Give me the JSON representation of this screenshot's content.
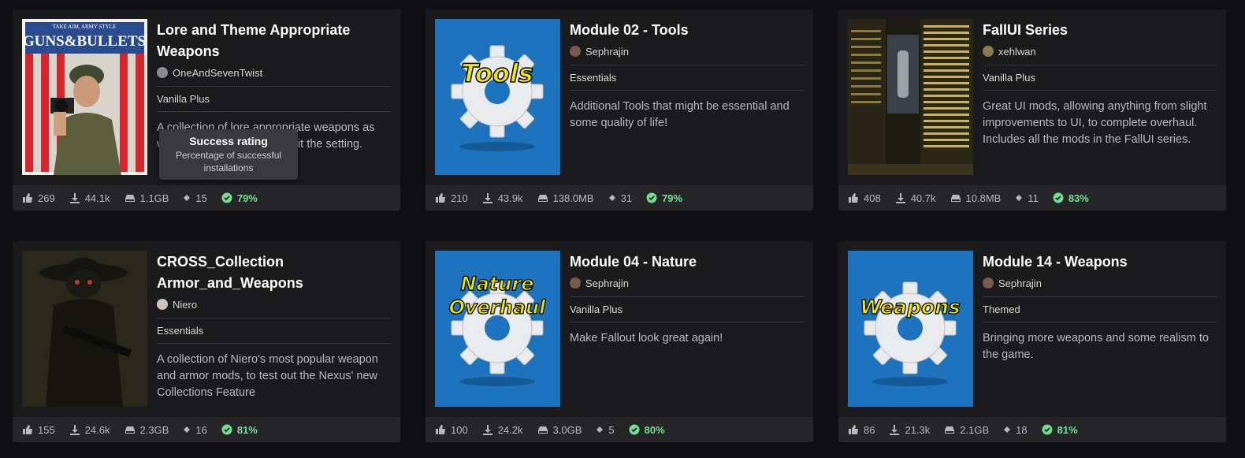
{
  "colors": {
    "background": "#101012",
    "card": "#1b1b1e",
    "stats_bar": "#262629",
    "success": "#6fe08f",
    "thumb_blue": "#1e73be",
    "gear_label": "#f2e600"
  },
  "icons": {
    "endorsements": "thumbs-up-icon",
    "downloads": "download-icon",
    "size": "hard-drive-icon",
    "mods": "diamond-icon",
    "success": "check-circle-icon"
  },
  "tooltip": {
    "title": "Success rating",
    "body": "Percentage of successful installations"
  },
  "cards": [
    {
      "title": "Lore and Theme Appropriate Weapons",
      "author": "OneAndSevenTwist",
      "category": "Vanilla Plus",
      "description": "A collection of lore appropriate weapons as well as mods that naturally fit the setting.",
      "thumb_label": "",
      "poster_top": "TAKE AIM, ARMY STYLE",
      "poster_brand": "GUNS&BULLETS",
      "stats": {
        "endorsements": "269",
        "downloads": "44.1k",
        "size": "1.1GB",
        "mods": "15",
        "success": "79%"
      }
    },
    {
      "title": "Module 02 - Tools",
      "author": "Sephrajin",
      "category": "Essentials",
      "description": "Additional Tools that might be essential and some quality of life!",
      "thumb_label": "Tools",
      "stats": {
        "endorsements": "210",
        "downloads": "43.9k",
        "size": "138.0MB",
        "mods": "31",
        "success": "79%"
      }
    },
    {
      "title": "FallUI Series",
      "author": "xehlwan",
      "category": "Vanilla Plus",
      "description": "Great UI mods, allowing anything from slight improvements to UI, to complete overhaul. Includes all the mods in the FallUI series.",
      "thumb_label": "",
      "stats": {
        "endorsements": "408",
        "downloads": "40.7k",
        "size": "10.8MB",
        "mods": "11",
        "success": "83%"
      }
    },
    {
      "title": "CROSS_Collection Armor_and_Weapons",
      "author": "Niero",
      "category": "Essentials",
      "description": "A collection of Niero's most popular weapon and armor mods, to test out the Nexus' new Collections Feature",
      "thumb_label": "",
      "stats": {
        "endorsements": "155",
        "downloads": "24.6k",
        "size": "2.3GB",
        "mods": "16",
        "success": "81%"
      }
    },
    {
      "title": "Module 04 - Nature",
      "author": "Sephrajin",
      "category": "Vanilla Plus",
      "description": "Make Fallout look great again!",
      "thumb_label": "Nature",
      "thumb_label2": "Overhaul",
      "stats": {
        "endorsements": "100",
        "downloads": "24.2k",
        "size": "3.0GB",
        "mods": "5",
        "success": "80%"
      }
    },
    {
      "title": "Module 14 - Weapons",
      "author": "Sephrajin",
      "category": "Themed",
      "description": "Bringing more weapons and some realism to the game.",
      "thumb_label": "Weapons",
      "stats": {
        "endorsements": "86",
        "downloads": "21.3k",
        "size": "2.1GB",
        "mods": "18",
        "success": "81%"
      }
    }
  ]
}
